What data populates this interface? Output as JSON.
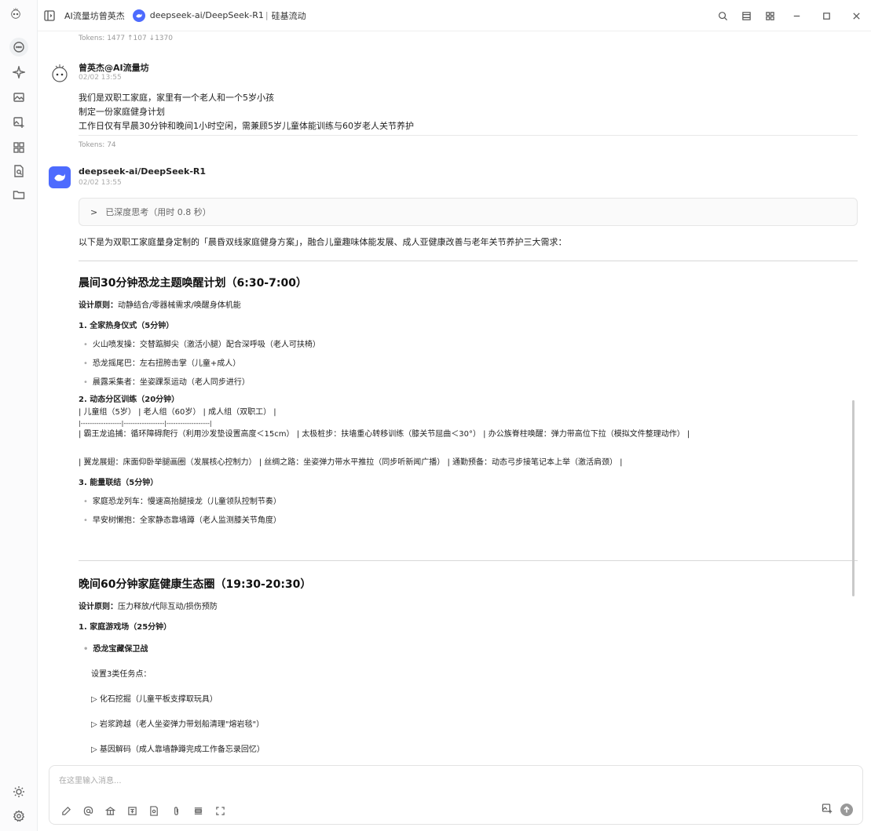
{
  "titlebar": {
    "title": "AI流量坊曾英杰",
    "model": "deepseek-ai/DeepSeek-R1",
    "separator": "|",
    "extra": "硅基流动"
  },
  "messages": {
    "prev_tokens": "Tokens: 1477 ↑107 ↓1370",
    "user": {
      "name": "曾英杰@AI流量坊",
      "time": "02/02 13:55",
      "lines": [
        "我们是双职工家庭，家里有一个老人和一个5岁小孩",
        "制定一份家庭健身计划",
        "工作日仅有早晨30分钟和晚间1小时空闲，需兼顾5岁儿童体能训练与60岁老人关节养护"
      ],
      "tokens": "Tokens: 74"
    },
    "assistant": {
      "name": "deepseek-ai/DeepSeek-R1",
      "time": "02/02 13:55",
      "think_label": "已深度思考（用时 0.8 秒）",
      "intro": "以下是为双职工家庭量身定制的「晨昏双线家庭健身方案」，融合儿童趣味体能发展、成人亚健康改善与老年关节养护三大需求：",
      "morning": {
        "title": "晨间30分钟恐龙主题唤醒计划（6:30-7:00）",
        "principle_label": "设计原则：",
        "principle": "动静结合/零器械需求/唤醒身体机能",
        "s1_title": "1. 全家热身仪式（5分钟）",
        "s1_items": [
          "火山喷发操：交替踮脚尖（激活小腿）配合深呼吸（老人可扶椅）",
          "恐龙摇尾巴：左右扭胯击掌（儿童+成人）",
          "晨露采集者：坐姿踝泵运动（老人同步进行）"
        ],
        "s2_title": "2. 动态分区训练（20分钟）",
        "s2_table_head": "| 儿童组（5岁） | 老人组（60岁） | 成人组（双职工） |",
        "s2_table_sep": "|------------------|------------------|-------------------|",
        "s2_row1": "| 霸王龙追捕：循环障碍爬行（利用沙发垫设置高度＜15cm） | 太极桩步：扶墙重心转移训练（膝关节屈曲＜30°） | 办公族脊柱唤醒：弹力带高位下拉（模拟文件整理动作） |",
        "s2_row2": "| 翼龙展翅：床面仰卧举腿画圈（发展核心控制力） | 丝绸之路：坐姿弹力带水平推拉（同步听新闻广播） | 通勤预备：动态弓步接笔记本上举（激活肩颈） |",
        "s3_title": "3. 能量联结（5分钟）",
        "s3_items": [
          "家庭恐龙列车：慢速高抬腿接龙（儿童领队控制节奏）",
          "早安树懒抱：全家静态靠墙蹲（老人监测膝关节角度）"
        ]
      },
      "evening": {
        "title": "晚间60分钟家庭健康生态圈（19:30-20:30）",
        "principle_label": "设计原则：",
        "principle": "压力释放/代际互动/损伤预防",
        "s1_title": "1. 家庭游戏场（25分钟）",
        "game_title": "恐龙宝藏保卫战",
        "game_intro": "设置3类任务点：",
        "tasks": [
          "▷ 化石挖掘（儿童平板支撑取玩具）",
          "▷ 岩浆跨越（老人坐姿弹力带划船清理\"熔岩毯\"）",
          "▷ 基因解码（成人靠墙静蹲完成工作备忘录回忆）"
        ]
      }
    }
  },
  "input": {
    "placeholder": "在这里输入消息..."
  },
  "icons": {
    "rail": [
      "chat-icon",
      "sparkle-icon",
      "image-icon",
      "image-edit-icon",
      "apps-icon",
      "document-search-icon",
      "folder-icon",
      "sun-icon",
      "settings-icon"
    ],
    "toolbar": [
      "edit-icon",
      "at-icon",
      "knowledge-icon",
      "translate-icon",
      "search-doc-icon",
      "attachment-icon",
      "clear-icon",
      "expand-icon"
    ]
  },
  "colors": {
    "accent": "#4d6bfe",
    "send_disabled": "#999999"
  }
}
